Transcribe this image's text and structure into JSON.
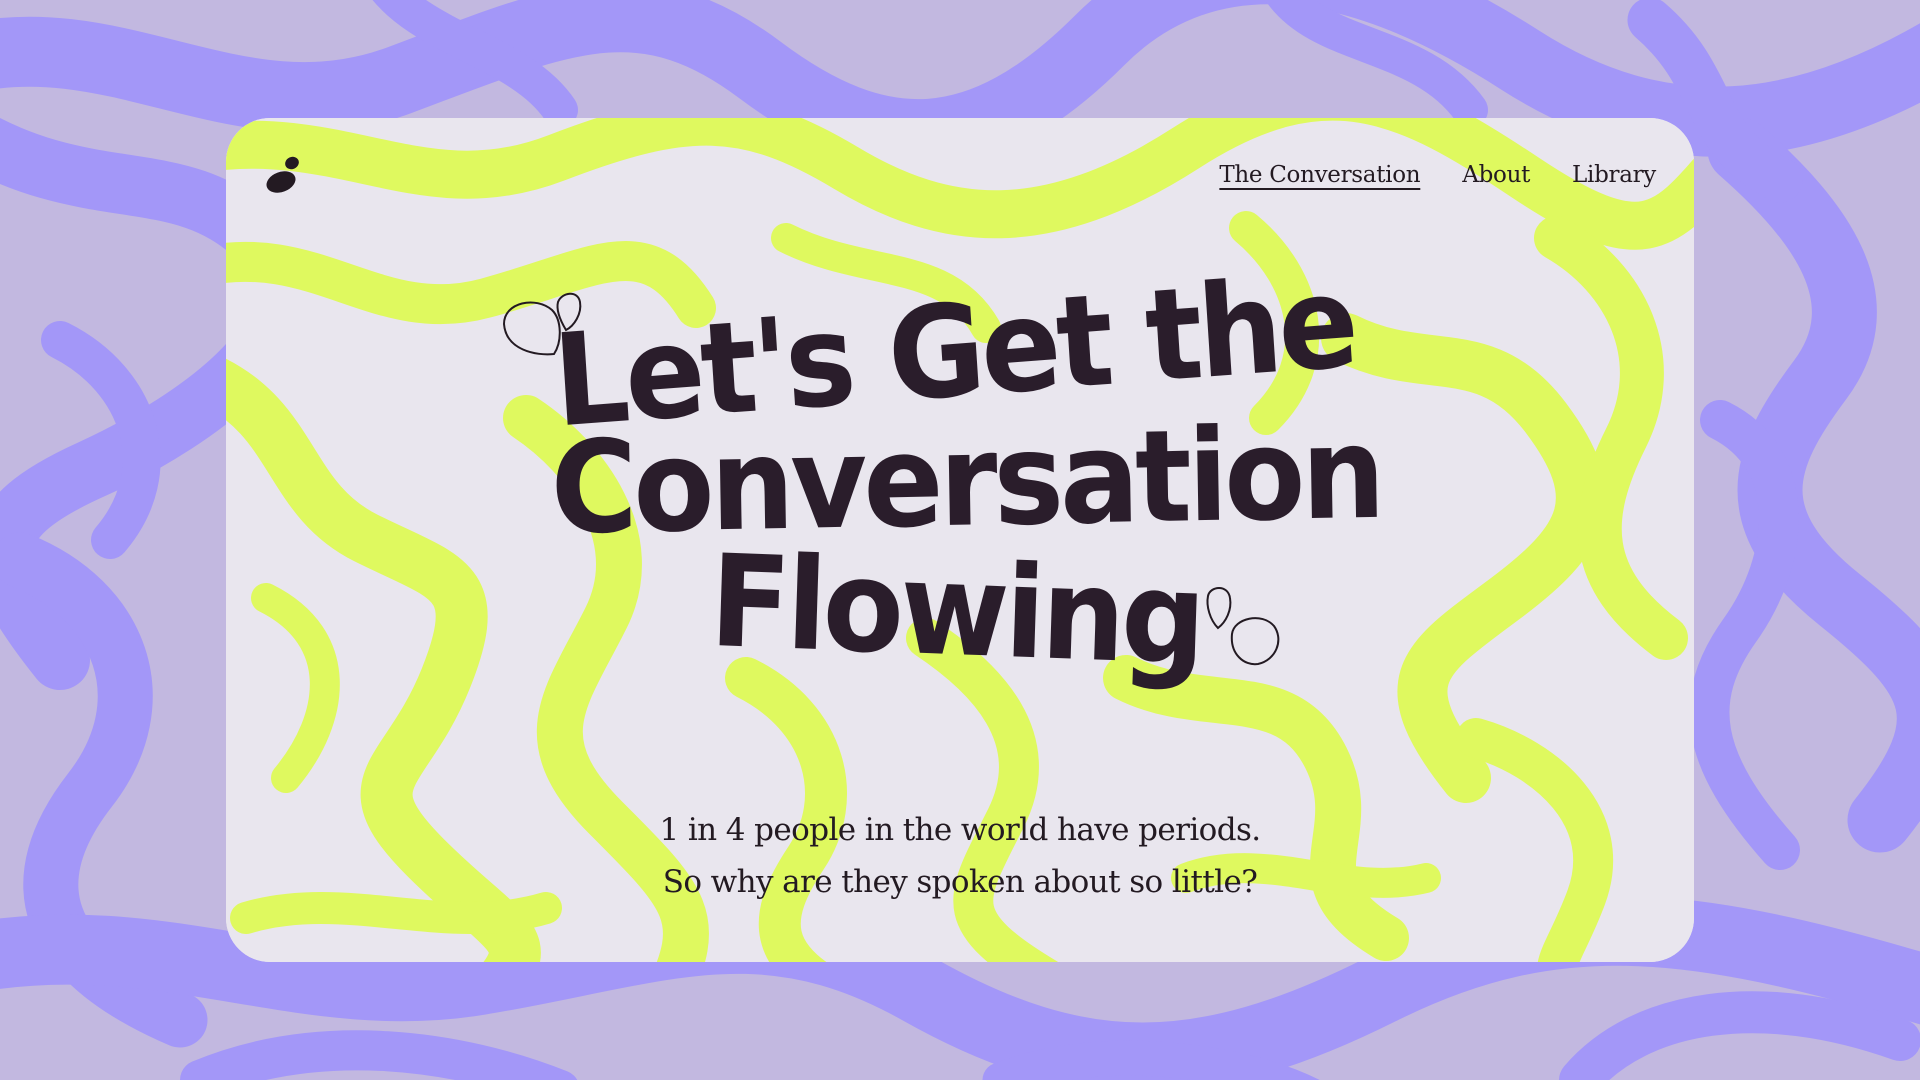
{
  "colors": {
    "outer_light": "#c2b8e0",
    "outer_purple": "#a397f8",
    "card_light": "#e9e6ee",
    "card_lime": "#dff95f",
    "ink": "#231a22"
  },
  "brand": {
    "logo_icon": "droplet-logo-icon"
  },
  "nav": {
    "items": [
      {
        "label": "The Conversation",
        "active": true
      },
      {
        "label": "About",
        "active": false
      },
      {
        "label": "Library",
        "active": false
      }
    ]
  },
  "hero": {
    "headline_lines": [
      "Let's Get the",
      "Conversation",
      "Flowing"
    ],
    "decor_icon": "droplet-outline-icon",
    "tagline_lines": [
      "1 in 4 people in the world have periods.",
      "So why are they spoken about so little?"
    ]
  }
}
